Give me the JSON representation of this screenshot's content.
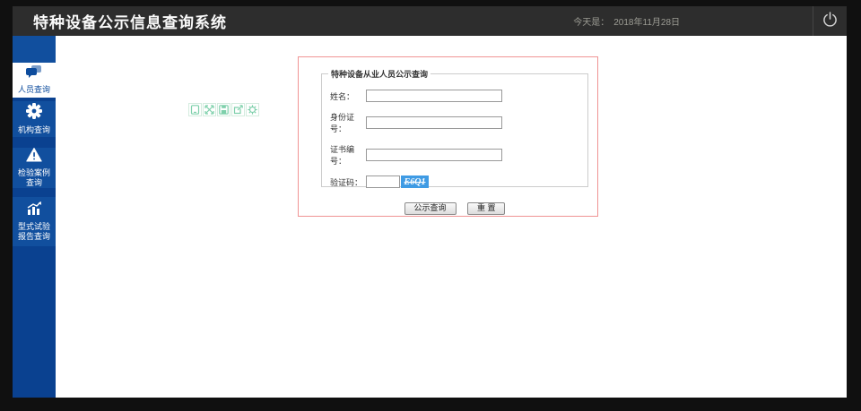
{
  "window": {
    "title": "特种设备公示信息查询系统",
    "date_label": "今天是：",
    "date_value": "2018年11月28日"
  },
  "sidebar": {
    "items": [
      {
        "label": "人员查询",
        "icon": "chat-icon",
        "active": true
      },
      {
        "label": "机构查询",
        "icon": "gear-icon",
        "active": false
      },
      {
        "label": "检验案例查询",
        "icon": "warning-icon",
        "active": false
      },
      {
        "label": "型式试验报告查询",
        "icon": "chart-icon",
        "active": false
      }
    ]
  },
  "mini_toolbar": {
    "icons": [
      "device-icon",
      "expand-icon",
      "save-icon",
      "export-icon",
      "settings-icon"
    ]
  },
  "form": {
    "legend": "特种设备从业人员公示查询",
    "fields": [
      {
        "label": "姓名：",
        "value": ""
      },
      {
        "label": "身份证号：",
        "value": ""
      },
      {
        "label": "证书编号：",
        "value": ""
      },
      {
        "label": "验证码：",
        "value": ""
      }
    ],
    "captcha_text": "E6Q1",
    "buttons": {
      "query": "公示查询",
      "reset": "重 置"
    }
  },
  "colors": {
    "header_bg": "#2d2d2d",
    "sidebar_base": "#0a4190",
    "sidebar_tile": "#114f9e",
    "active_blue": "#0d4c9d",
    "form_border_red": "#f09494",
    "captcha_bg": "#3f9be4",
    "mini_icon_green": "#7ed0ab"
  }
}
